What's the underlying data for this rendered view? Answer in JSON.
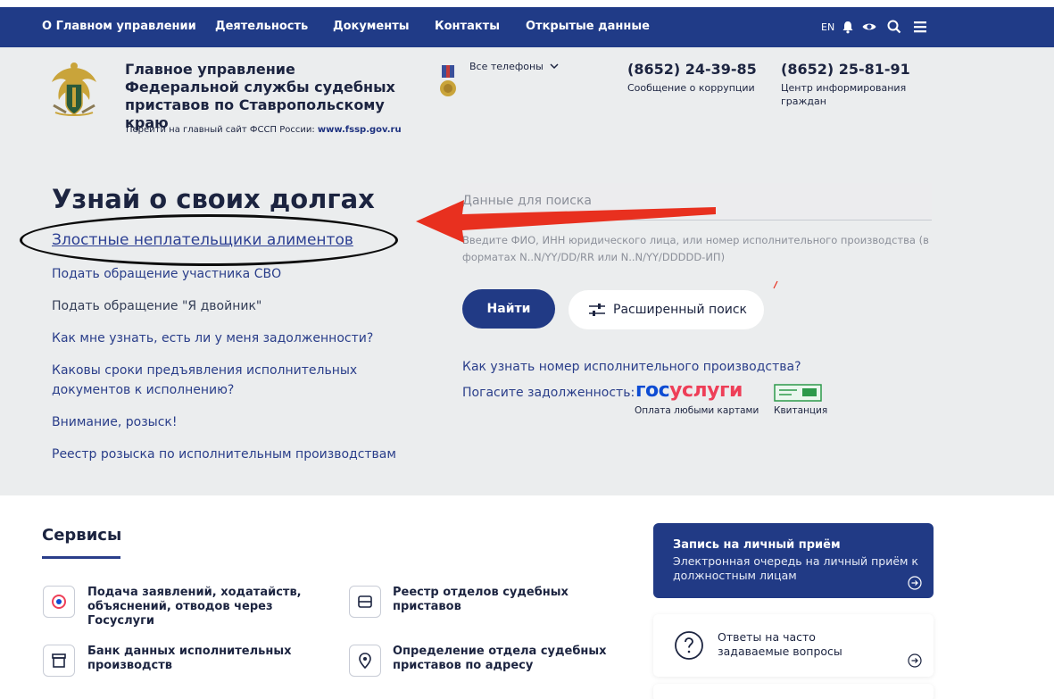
{
  "nav": {
    "items": [
      "О Главном управлении",
      "Деятельность",
      "Документы",
      "Контакты",
      "Открытые данные"
    ],
    "lang": "EN",
    "icons": [
      "bell-icon",
      "eye-icon",
      "search-icon",
      "menu-icon"
    ]
  },
  "header": {
    "org_title": "Главное управление Федеральной службы судебных приставов по Ставропольскому краю",
    "main_site_text": "Перейти на главный сайт ФССП России:",
    "main_site_link": "www.fssp.gov.ru",
    "all_phones": "Все телефоны",
    "phone1": "(8652) 24-39-85",
    "phone1_label": "Сообщение о коррупции",
    "phone2": "(8652) 25-81-91",
    "phone2_label": "Центр информирования граждан"
  },
  "hero": {
    "title": "Узнай о своих долгах",
    "links": [
      "Злостные неплательщики алиментов",
      "Подать обращение участника СВО",
      "Подать обращение \"Я двойник\"",
      "Как мне узнать, есть ли у меня задолженности?",
      "Каковы сроки предъявления исполнительных документов к исполнению?",
      "Внимание, розыск!",
      "Реестр розыска по исполнительным производствам"
    ],
    "search_placeholder": "Данные для поиска",
    "search_hint": "Введите ФИО, ИНН юридического лица, или номер исполнительного производства (в форматах N..N/YY/DD/RR или N..N/YY/DDDDD-ИП)",
    "find_button": "Найти",
    "advanced_button": "Расширенный поиск",
    "number_question": "Как узнать номер исполнительного производства?",
    "pay_label": "Погасите задолженность:",
    "gos_a": "гос",
    "gos_b": "услуги",
    "gos_sub": "Оплата любыми картами",
    "kvit_sub": "Квитанция"
  },
  "services": {
    "title": "Сервисы",
    "items": [
      "Подача заявлений, ходатайств, объяснений, отводов через Госуслуги",
      "Реестр отделов судебных приставов",
      "Банк данных исполнительных производств",
      "Определение отдела судебных приставов по адресу"
    ]
  },
  "cards": {
    "appointment_title": "Запись на личный приём",
    "appointment_text": "Электронная очередь на личный приём к должностным лицам",
    "faq_text": "Ответы на часто задаваемые вопросы"
  },
  "colors": {
    "navy": "#213a85",
    "header_bg": "#ebedee",
    "gos_blue": "#0d4cd3",
    "gos_red": "#ee3f58",
    "annotation_red": "#e8301f"
  }
}
